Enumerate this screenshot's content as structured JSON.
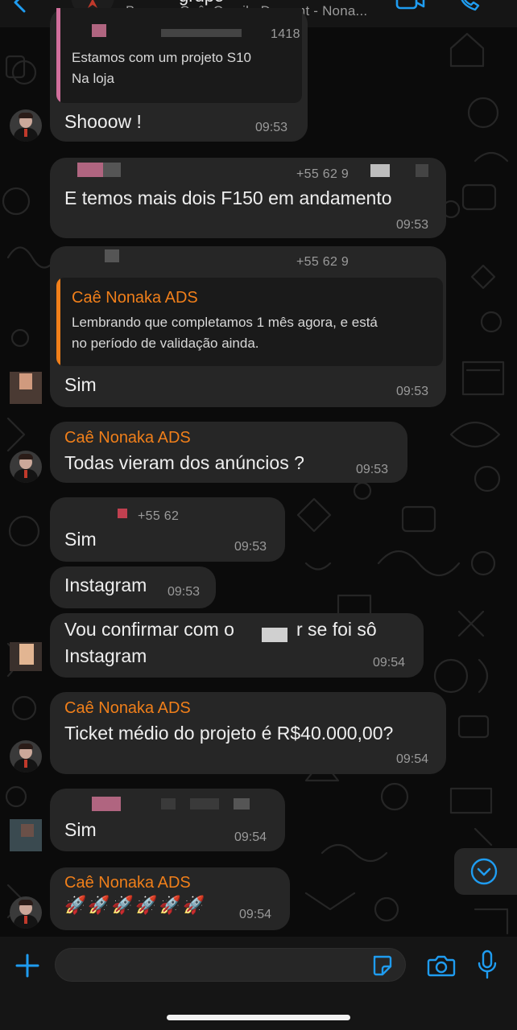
{
  "header": {
    "title": "grupo",
    "subtitle": "Bruno -, Caê, Camila Dumont - Nona..."
  },
  "messages": [
    {
      "phone": "+55 62 9 ... 1418",
      "text_lines": [
        "Estamos com um projeto S10",
        "Na loja"
      ],
      "reply": "Shooow !",
      "time": "09:53"
    },
    {
      "phone": "+55 62 9",
      "text": "E temos mais dois F150 em andamento",
      "time": "09:53"
    },
    {
      "phone": "+55 62 9",
      "quote_sender": "Caê Nonaka ADS",
      "quote_lines": [
        "Lembrando que completamos 1 mês agora, e está",
        "no período de validação ainda."
      ],
      "text": "Sim",
      "time": "09:53"
    },
    {
      "sender": "Caê Nonaka ADS",
      "text": "Todas vieram dos anúncios ?",
      "time": "09:53"
    },
    {
      "phone": "+55 62",
      "text": "Sim",
      "time": "09:53"
    },
    {
      "text": "Instagram",
      "time": "09:53"
    },
    {
      "line1_start": "Vou confirmar com o",
      "line1_end": "r se foi sô",
      "line2": "Instagram",
      "time": "09:54"
    },
    {
      "sender": "Caê Nonaka ADS",
      "text": "Ticket médio do projeto é R$40.000,00?",
      "time": "09:54"
    },
    {
      "text": "Sim",
      "time": "09:54"
    },
    {
      "sender": "Caê Nonaka ADS",
      "text": "🚀🚀🚀🚀🚀🚀",
      "time": "09:54"
    }
  ],
  "composer": {
    "value": "",
    "placeholder": ""
  },
  "icons": [
    "back-chevron-icon",
    "video-call-icon",
    "phone-call-icon",
    "scroll-down-icon",
    "plus-icon",
    "sticker-icon",
    "camera-icon",
    "microphone-icon"
  ],
  "colors": {
    "background": "#0b0b0b",
    "bubble": "#262626",
    "sender": "#f07f1a",
    "accent_blue": "#1f9cf0",
    "quote_bar_pink": "#d16f9c",
    "quote_bar_orange": "#f07f1a"
  }
}
